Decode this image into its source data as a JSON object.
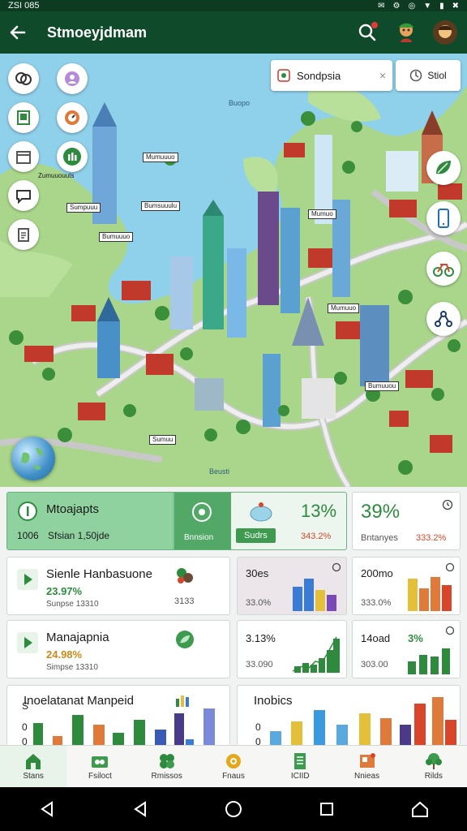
{
  "status_bar": {
    "time": "ZSI 085",
    "icons": [
      "✉",
      "⚙",
      "◎",
      "▼",
      "▮",
      "✖"
    ]
  },
  "app_bar": {
    "title": "Stmoeyjdmam"
  },
  "map": {
    "search": {
      "value": "Sondpsia",
      "clear": "×"
    },
    "chip_label": "Stiol",
    "water_labels": [
      "Buopo",
      "Beusti"
    ],
    "place_labels": [
      "Zumuuouuts",
      "Mumuuuo",
      "Bumsuuulu",
      "Sumpuuu",
      "Bumuuuo",
      "Mumuo",
      "Mumuuo",
      "Bumuuou",
      "Sumuu"
    ]
  },
  "cards": {
    "summary": {
      "title": "Mtoajapts",
      "value": "1006",
      "sub": "Sfsian 1,50jde"
    },
    "summary_mid": {
      "label": "Bnnsion"
    },
    "summary_right": {
      "value": "13%",
      "pill": "Sudrs",
      "delta": "343.2%"
    },
    "kpi_top_right": {
      "value": "39%",
      "label": "Bntanyes",
      "delta": "333.2%"
    },
    "list1": {
      "title": "Sienle Hanbasuone",
      "value": "23.97%",
      "sub": "Sunpse 13310"
    },
    "list1_right": {
      "value": "3133"
    },
    "bar1": {
      "title": "30es",
      "value": "33.0%"
    },
    "bar2": {
      "title": "200mo",
      "value": "333.0%"
    },
    "list2": {
      "title": "Manajapnia",
      "value": "24.98%",
      "sub": "Simpse 13310"
    },
    "line1": {
      "title": "3.13%",
      "value": "33.090"
    },
    "line2": {
      "title": "14oad",
      "badge": "3%",
      "value": "303.00"
    },
    "big1": {
      "title": "Inoelatanat Manpeid",
      "axis": [
        "S",
        "0",
        "0"
      ]
    },
    "big2": {
      "title": "Inobics",
      "axis": [
        "0",
        "0"
      ]
    }
  },
  "bottom_nav": [
    {
      "label": "Stans",
      "active": true
    },
    {
      "label": "Fsiloct",
      "active": false
    },
    {
      "label": "Rmissos",
      "active": false
    },
    {
      "label": "Fnaus",
      "active": false
    },
    {
      "label": "ICIID",
      "active": false
    },
    {
      "label": "Nnieas",
      "active": false
    },
    {
      "label": "Rilds",
      "active": false
    }
  ],
  "colors": {
    "app_bar": "#0f4a2a",
    "accent": "#3d9a4e",
    "map_water": "#8fd0ea",
    "land": "#a9d68a"
  }
}
